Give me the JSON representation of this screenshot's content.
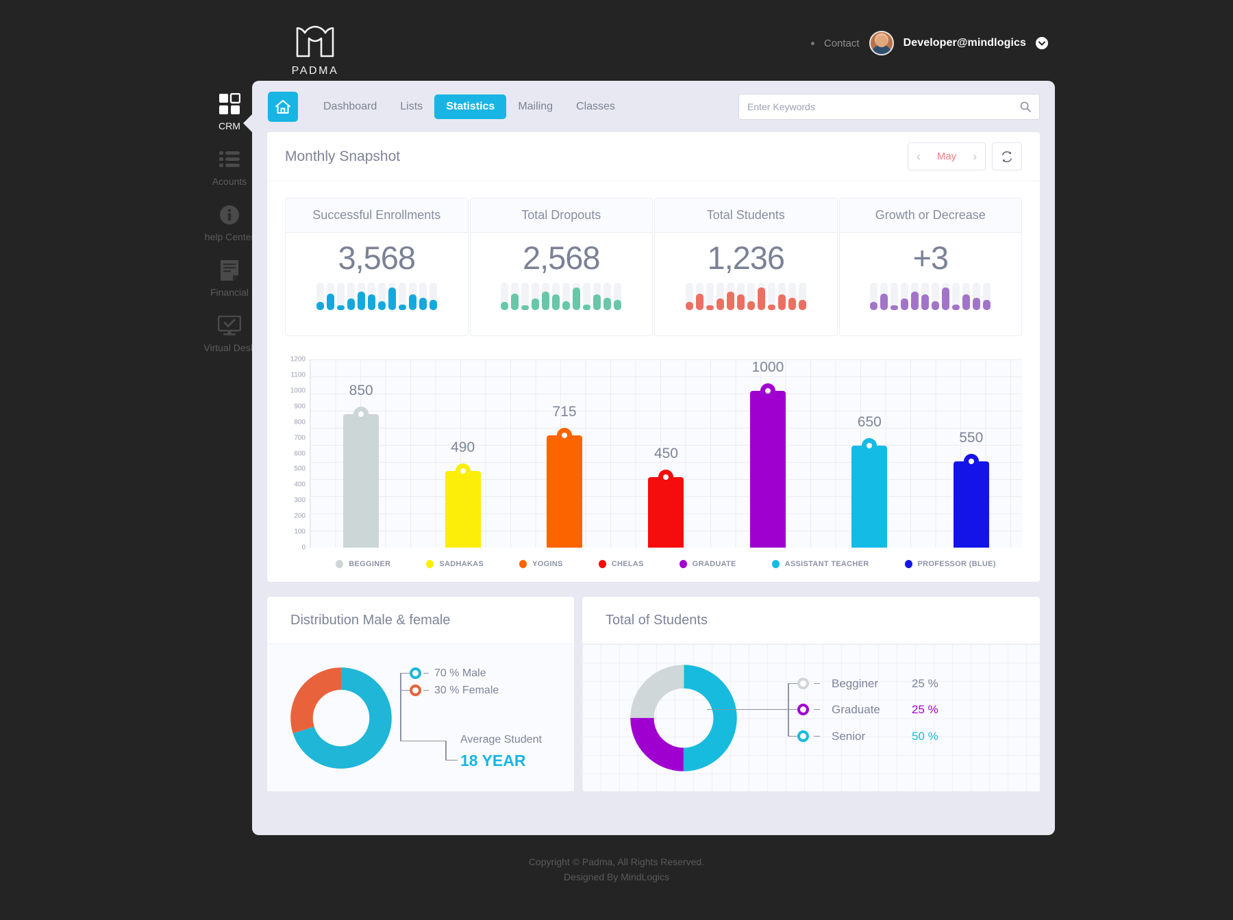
{
  "brand": {
    "name": "PADMA",
    "logo_icon": "padma-lotus-logo"
  },
  "topbar": {
    "contact_label": "Contact",
    "user_name": "Developer@mindlogics",
    "caret_icon": "chevron-down-icon",
    "avatar_icon": "user-avatar"
  },
  "sidebar": {
    "items": [
      {
        "label": "CRM",
        "icon": "grid-squares-icon",
        "active": true
      },
      {
        "label": "Acounts",
        "icon": "list-icon",
        "active": false
      },
      {
        "label": "help Center",
        "icon": "info-circle-icon",
        "active": false
      },
      {
        "label": "Financial",
        "icon": "document-icon",
        "active": false
      },
      {
        "label": "Virtual Desk",
        "icon": "monitor-check-icon",
        "active": false
      }
    ]
  },
  "nav": {
    "home_icon": "home-icon",
    "tabs": [
      {
        "label": "Dashboard",
        "active": false
      },
      {
        "label": "Lists",
        "active": false
      },
      {
        "label": "Statistics",
        "active": true
      },
      {
        "label": "Mailing",
        "active": false
      },
      {
        "label": "Classes",
        "active": false
      }
    ],
    "search": {
      "placeholder": "Enter Keywords",
      "value": "",
      "icon": "search-icon"
    }
  },
  "panel": {
    "title": "Monthly Snapshot",
    "month": "May",
    "prev_icon": "chevron-left-icon",
    "next_icon": "chevron-right-icon",
    "refresh_icon": "refresh-icon"
  },
  "kpis": [
    {
      "title": "Successful Enrollments",
      "value": "3,568",
      "color": "#14a9dd",
      "spark": [
        30,
        60,
        18,
        42,
        66,
        58,
        32,
        82,
        20,
        56,
        44,
        36
      ]
    },
    {
      "title": "Total Dropouts",
      "value": "2,568",
      "color": "#68c7a7",
      "spark": [
        30,
        60,
        18,
        42,
        66,
        58,
        32,
        82,
        20,
        56,
        44,
        36
      ]
    },
    {
      "title": "Total Students",
      "value": "1,236",
      "color": "#ec7062",
      "spark": [
        30,
        60,
        18,
        42,
        66,
        58,
        32,
        82,
        20,
        56,
        44,
        36
      ]
    },
    {
      "title": "Growth or Decrease",
      "value": "+3",
      "color": "#a274c8",
      "spark": [
        30,
        60,
        18,
        42,
        66,
        58,
        32,
        82,
        20,
        56,
        44,
        36
      ]
    }
  ],
  "chart_data": {
    "type": "bar",
    "title": "Monthly Snapshot",
    "xlabel": "",
    "ylabel": "",
    "ylim": [
      0,
      1200
    ],
    "ticks": [
      "1200",
      "1100",
      "1000",
      "900",
      "800",
      "700",
      "600",
      "500",
      "400",
      "300",
      "200",
      "100",
      "0"
    ],
    "grid": true,
    "legend_position": "bottom",
    "categories": [
      "BEGGINER",
      "SADHAKAS",
      "YOGINS",
      "CHELAS",
      "GRADUATE",
      "ASSISTANT TEACHER",
      "PROFESSOR (BLUE)"
    ],
    "values": [
      850,
      490,
      715,
      450,
      1000,
      650,
      550
    ],
    "colors": [
      "#cdd6d6",
      "#fcee08",
      "#fc6400",
      "#f50c0c",
      "#a000cf",
      "#14bbe5",
      "#1414e8"
    ],
    "labels": [
      "850",
      "490",
      "715",
      "450",
      "1000",
      "650",
      "550"
    ]
  },
  "distribution": {
    "title": "Distribution Male & female",
    "chart_data": {
      "type": "pie",
      "title": "Distribution Male & female",
      "labels": [
        "70 % Male",
        "30 % Female"
      ],
      "values": [
        70,
        30
      ],
      "colors": [
        "#1fb6d8",
        "#e8633c"
      ]
    },
    "legend": [
      {
        "label": "70 % Male",
        "color": "#1fb6d8"
      },
      {
        "label": "30 % Female",
        "color": "#e8633c"
      }
    ],
    "average_label": "Average Student",
    "average_value": "18 YEAR"
  },
  "total_students": {
    "title": "Total of Students",
    "chart_data": {
      "type": "pie",
      "title": "Total of Students",
      "labels": [
        "Begginer",
        "Graduate",
        "Senior"
      ],
      "values": [
        25,
        25,
        50
      ],
      "colors": [
        "#cfd7d8",
        "#a000cf",
        "#17bbdd"
      ]
    },
    "legend": [
      {
        "label": "Begginer",
        "percent": "25 %",
        "color": "#cfd7d8",
        "text_color": "#7d8499"
      },
      {
        "label": "Graduate",
        "percent": "25 %",
        "color": "#a000cf",
        "text_color": "#a000cf"
      },
      {
        "label": "Senior",
        "percent": "50 %",
        "color": "#17bbdd",
        "text_color": "#17bbdd"
      }
    ]
  },
  "footer": {
    "line1": "Copyright © Padma, All Rights Reserved.",
    "line2": "Designed By MindLogics"
  }
}
